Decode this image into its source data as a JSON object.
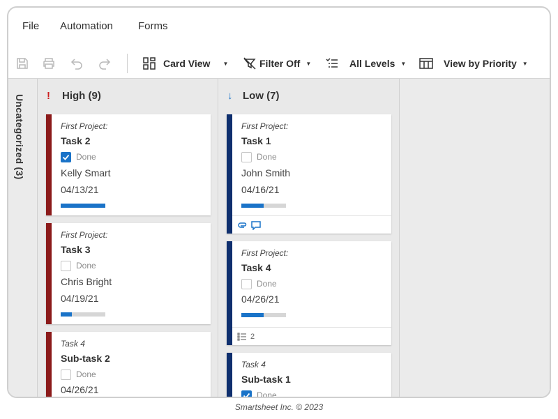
{
  "menu": {
    "file": "File",
    "automation": "Automation",
    "forms": "Forms"
  },
  "toolbar": {
    "card_view": "Card View",
    "filter": "Filter Off",
    "levels": "All Levels",
    "view_by": "View by Priority"
  },
  "uncategorized": {
    "label": "Uncategorized (3)"
  },
  "lanes": {
    "high": {
      "label": "High (9)",
      "icon": "!",
      "color": "#cc1f1f"
    },
    "low": {
      "label": "Low (7)",
      "icon": "↓",
      "color": "#1a73c8"
    }
  },
  "colors": {
    "high_bar": "#8b1a1a",
    "low_bar": "#0f2f6e",
    "progress": "#1a73c8",
    "checkbox": "#1a73c8"
  },
  "cards": {
    "h1": {
      "project": "First Project:",
      "title": "Task 2",
      "done_label": "Done",
      "done": true,
      "person": "Kelly Smart",
      "date": "04/13/21",
      "progress": 1.0
    },
    "h2": {
      "project": "First Project:",
      "title": "Task 3",
      "done_label": "Done",
      "done": false,
      "person": "Chris Bright",
      "date": "04/19/21",
      "progress": 0.25
    },
    "h3": {
      "project": "Task 4",
      "title": "Sub-task 2",
      "done_label": "Done",
      "done": false,
      "date": "04/26/21"
    },
    "l1": {
      "project": "First Project:",
      "title": "Task 1",
      "done_label": "Done",
      "done": false,
      "person": "John Smith",
      "date": "04/16/21",
      "progress": 0.5,
      "icons": [
        "attachment-icon",
        "comment-icon"
      ]
    },
    "l2": {
      "project": "First Project:",
      "title": "Task 4",
      "done_label": "Done",
      "done": false,
      "date": "04/26/21",
      "progress": 0.5,
      "subtasks": "2"
    },
    "l3": {
      "project": "Task 4",
      "title": "Sub-task 1",
      "done_label": "Done",
      "done": true
    }
  },
  "footer": {
    "credit": "Smartsheet Inc. © 2023"
  }
}
